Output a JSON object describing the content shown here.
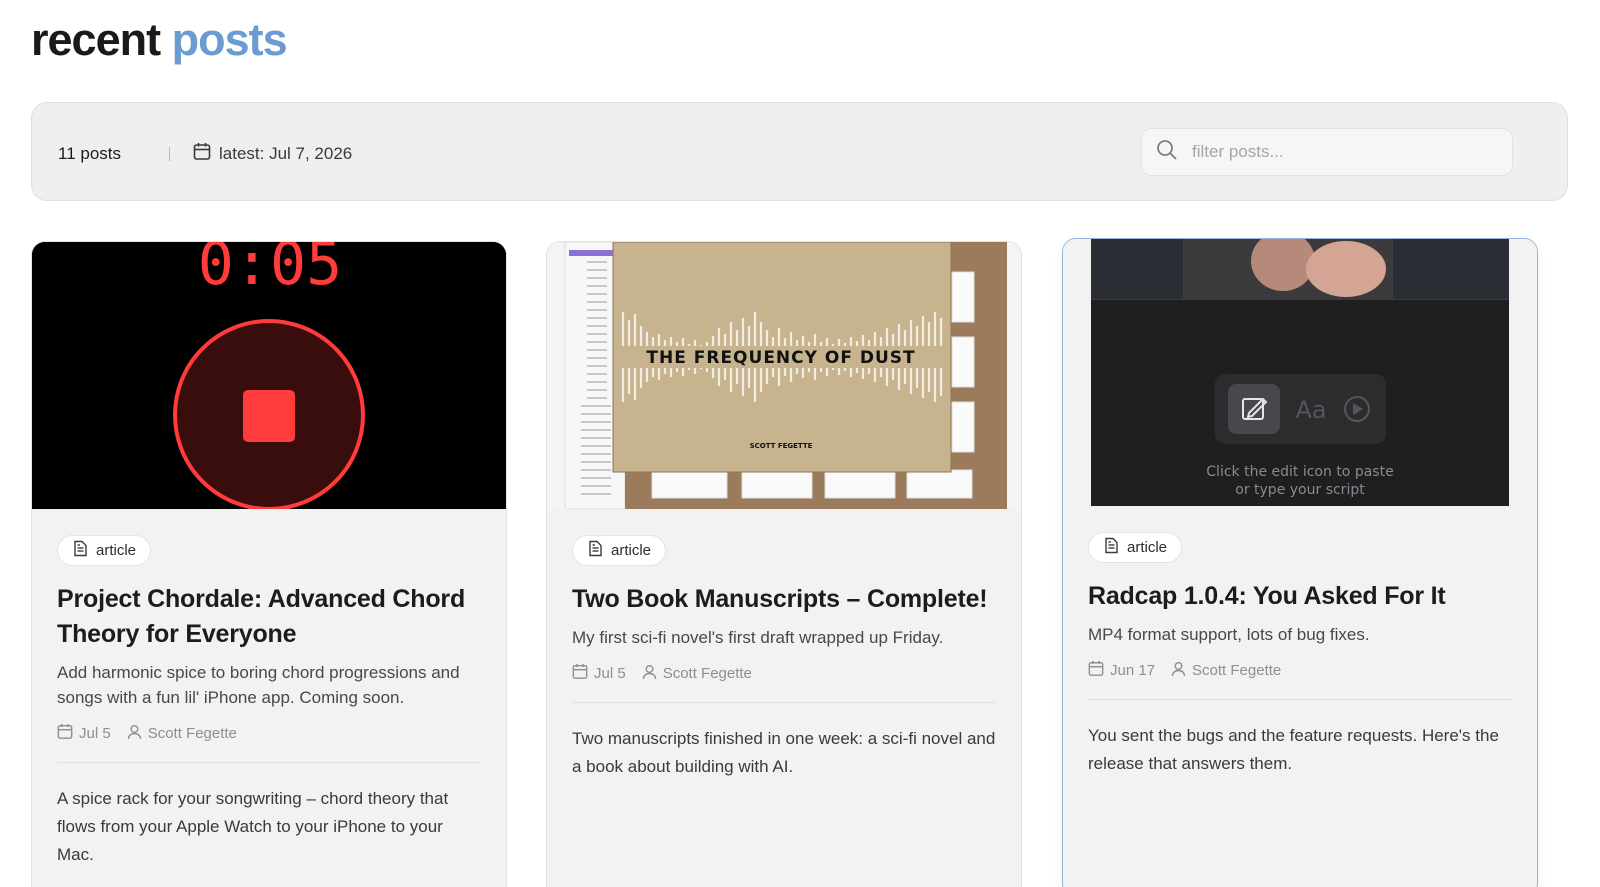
{
  "page": {
    "title_main": "recent",
    "title_accent": "posts"
  },
  "toolbar": {
    "count": "11 posts",
    "latest": "latest: Jul 7, 2026",
    "search_placeholder": "filter posts..."
  },
  "posts": [
    {
      "badge": "article",
      "title": "Project Chordale: Advanced Chord Theory for Everyone",
      "description": "Add harmonic spice to boring chord progressions and songs with a fun lil' iPhone app. Coming soon.",
      "date": "Jul 5",
      "author": "Scott Fegette",
      "excerpt": "A spice rack for your songwriting – chord theory that flows from your Apple Watch to your iPhone to your Mac.",
      "thumb_timer": "0:05"
    },
    {
      "badge": "article",
      "title": "Two Book Manuscripts – Complete!",
      "description": "My first sci-fi novel's first draft wrapped up Friday.",
      "date": "Jul 5",
      "author": "Scott Fegette",
      "excerpt": "Two manuscripts finished in one week: a sci-fi novel and a book about building with AI.",
      "thumb_book_title": "THE FREQUENCY OF DUST",
      "thumb_book_author": "SCOTT FEGETTE"
    },
    {
      "badge": "article",
      "title": "Radcap 1.0.4: You Asked For It",
      "description": "MP4 format support, lots of bug fixes.",
      "date": "Jun 17",
      "author": "Scott Fegette",
      "excerpt": "You sent the bugs and the feature requests. Here's the release that answers them.",
      "thumb_hint_line1": "Click the edit icon to paste",
      "thumb_hint_line2": "or type your script",
      "thumb_aa": "Aa"
    }
  ],
  "colors": {
    "accent": "#6b9bd1",
    "recording_red": "#ff3b3b"
  }
}
